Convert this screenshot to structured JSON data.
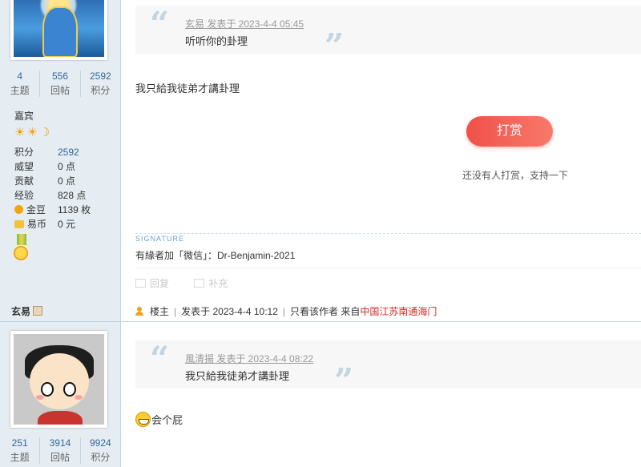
{
  "user1": {
    "stats": [
      {
        "value": "4",
        "label": "主题"
      },
      {
        "value": "556",
        "label": "回帖"
      },
      {
        "value": "2592",
        "label": "积分"
      }
    ],
    "name": "嘉宾",
    "stars": "☀☀☽",
    "info": [
      {
        "key": "积分",
        "value": "2592"
      },
      {
        "key": "威望",
        "value": "0 点"
      },
      {
        "key": "贡献",
        "value": "0 点"
      },
      {
        "key": "经验",
        "value": "828 点"
      },
      {
        "key": "金豆",
        "value": "1139 枚"
      },
      {
        "key": "易币",
        "value": "0 元"
      }
    ]
  },
  "user2": {
    "name": "玄易",
    "stats": [
      {
        "value": "251",
        "label": "主题"
      },
      {
        "value": "3914",
        "label": "回帖"
      },
      {
        "value": "9924",
        "label": "积分"
      }
    ]
  },
  "post1": {
    "quote_meta": "玄易 发表于 2023-4-4 05:45",
    "quote_text": "听听你的卦理",
    "body": "我只給我徒弟才講卦理",
    "reward_button": "打赏",
    "reward_note": "还没有人打赏，支持一下",
    "signature_label": "SIGNATURE",
    "signature": "有緣者加「微信」：Dr-Benjamin-2021",
    "actions": [
      "回复",
      "补充"
    ]
  },
  "post2": {
    "author_role": "楼主",
    "posted": "发表于 2023-4-4 10:12",
    "only_author": "只看该作者",
    "from_label": "来自",
    "location": "中国江苏南通海门",
    "quote_meta": "風清揚 发表于 2023-4-4 08:22",
    "quote_text": "我只給我徒弟才講卦理",
    "body": "会个屁"
  }
}
